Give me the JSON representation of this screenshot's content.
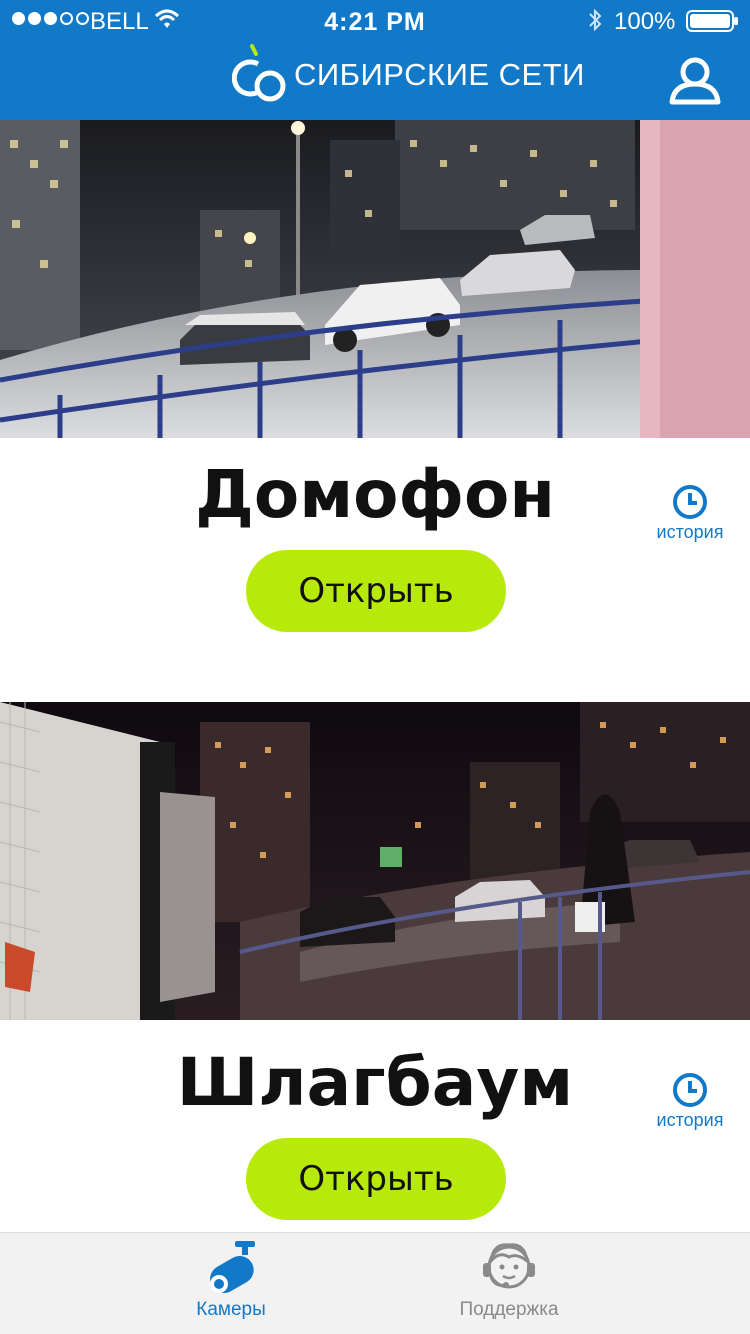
{
  "status_bar": {
    "carrier": "BELL",
    "time": "4:21 PM",
    "battery": "100%",
    "signal_bars_filled": 3,
    "signal_bars_total": 5
  },
  "header": {
    "brand_name": "СИБИРСКИЕ СЕТИ",
    "profile_icon": "user-icon"
  },
  "cards": [
    {
      "title": "Домофон",
      "open_label": "Открыть",
      "history_label": "история",
      "history_icon": "clock-icon"
    },
    {
      "title": "Шлагбаум",
      "open_label": "Открыть",
      "history_label": "история",
      "history_icon": "clock-icon"
    }
  ],
  "tabbar": {
    "tabs": [
      {
        "label": "Камеры",
        "icon": "camera-icon",
        "active": true
      },
      {
        "label": "Поддержка",
        "icon": "support-agent-icon",
        "active": false
      }
    ]
  },
  "colors": {
    "brand_blue": "#1279c8",
    "button_green": "#b7ea0b",
    "tab_inactive": "#8a8a8a"
  }
}
